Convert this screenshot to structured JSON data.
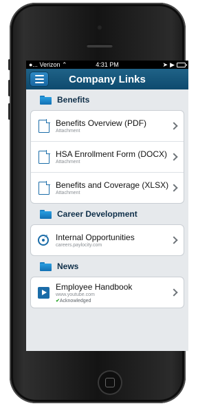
{
  "status_bar": {
    "carrier": "Verizon",
    "time": "4:31 PM"
  },
  "navbar": {
    "title": "Company Links"
  },
  "sections": [
    {
      "title": "Benefits",
      "items": [
        {
          "title": "Benefits Overview (PDF)",
          "subtitle": "Attachment",
          "icon": "document-icon"
        },
        {
          "title": "HSA Enrollment Form (DOCX)",
          "subtitle": "Attachment",
          "icon": "document-icon"
        },
        {
          "title": "Benefits and Coverage (XLSX)",
          "subtitle": "Attachment",
          "icon": "document-icon"
        }
      ]
    },
    {
      "title": "Career Development",
      "items": [
        {
          "title": "Internal Opportunities",
          "subtitle": "careers.paylocity.com",
          "icon": "target-icon"
        }
      ]
    },
    {
      "title": "News",
      "items": [
        {
          "title": "Employee Handbook",
          "subtitle": "www.youtube.com",
          "status": "Acknowledged",
          "icon": "video-icon"
        }
      ]
    }
  ]
}
